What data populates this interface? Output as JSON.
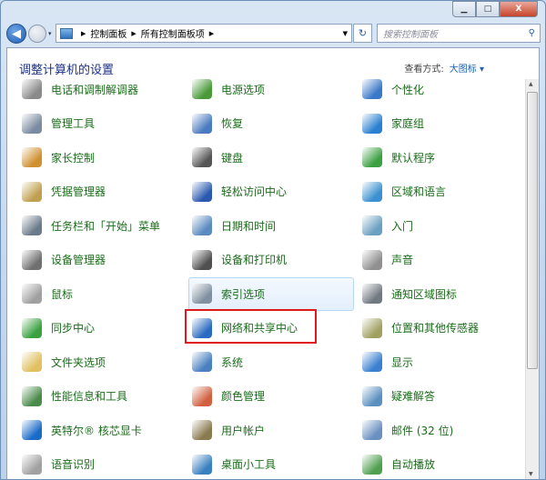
{
  "window": {
    "minimize": "▁",
    "maximize": "□",
    "close": "X"
  },
  "nav": {
    "back": "◀",
    "dropdown": "▾"
  },
  "breadcrumb": [
    "控制面板",
    "所有控制面板项"
  ],
  "search": {
    "placeholder": "搜索控制面板",
    "icon": "⚲"
  },
  "refresh": "↻",
  "header": {
    "title": "调整计算机的设置",
    "view_label": "查看方式:",
    "view_value": "大图标 ▾"
  },
  "items": [
    {
      "label": "电话和调制解调器",
      "icon": "phone-modem-icon",
      "color": "#8a8a8a"
    },
    {
      "label": "电源选项",
      "icon": "power-icon",
      "color": "#4a9a3a"
    },
    {
      "label": "个性化",
      "icon": "personalize-icon",
      "color": "#3a78c8"
    },
    {
      "label": "管理工具",
      "icon": "admin-tools-icon",
      "color": "#7a8aa0"
    },
    {
      "label": "恢复",
      "icon": "recovery-icon",
      "color": "#4a7ac0"
    },
    {
      "label": "家庭组",
      "icon": "homegroup-icon",
      "color": "#2a80d0"
    },
    {
      "label": "家长控制",
      "icon": "parental-icon",
      "color": "#d09030"
    },
    {
      "label": "键盘",
      "icon": "keyboard-icon",
      "color": "#555555"
    },
    {
      "label": "默认程序",
      "icon": "default-programs-icon",
      "color": "#3aa040"
    },
    {
      "label": "凭据管理器",
      "icon": "credential-icon",
      "color": "#c0a050"
    },
    {
      "label": "轻松访问中心",
      "icon": "ease-access-icon",
      "color": "#2a5ab0"
    },
    {
      "label": "区域和语言",
      "icon": "region-icon",
      "color": "#3a90d0"
    },
    {
      "label": "任务栏和「开始」菜单",
      "icon": "taskbar-icon",
      "color": "#6a7a8a"
    },
    {
      "label": "日期和时间",
      "icon": "datetime-icon",
      "color": "#5a8ac0"
    },
    {
      "label": "入门",
      "icon": "getting-started-icon",
      "color": "#6aa0c0"
    },
    {
      "label": "设备管理器",
      "icon": "device-manager-icon",
      "color": "#707070"
    },
    {
      "label": "设备和打印机",
      "icon": "printer-icon",
      "color": "#505050"
    },
    {
      "label": "声音",
      "icon": "sound-icon",
      "color": "#909090"
    },
    {
      "label": "鼠标",
      "icon": "mouse-icon",
      "color": "#a0a0a0"
    },
    {
      "label": "索引选项",
      "icon": "indexing-icon",
      "color": "#8090a0"
    },
    {
      "label": "通知区域图标",
      "icon": "notification-icon",
      "color": "#707880"
    },
    {
      "label": "同步中心",
      "icon": "sync-icon",
      "color": "#3aa040"
    },
    {
      "label": "网络和共享中心",
      "icon": "network-icon",
      "color": "#2a6ac0"
    },
    {
      "label": "位置和其他传感器",
      "icon": "sensor-icon",
      "color": "#a0a060"
    },
    {
      "label": "文件夹选项",
      "icon": "folder-icon",
      "color": "#e0c060"
    },
    {
      "label": "系统",
      "icon": "system-icon",
      "color": "#4a80c0"
    },
    {
      "label": "显示",
      "icon": "display-icon",
      "color": "#3a80d0"
    },
    {
      "label": "性能信息和工具",
      "icon": "performance-icon",
      "color": "#4a8a4a"
    },
    {
      "label": "颜色管理",
      "icon": "color-management-icon",
      "color": "#d06040"
    },
    {
      "label": "疑难解答",
      "icon": "troubleshoot-icon",
      "color": "#5a90c0"
    },
    {
      "label": "英特尔® 核芯显卡",
      "icon": "intel-graphics-icon",
      "color": "#1a6ac8"
    },
    {
      "label": "用户帐户",
      "icon": "user-accounts-icon",
      "color": "#8a7a50"
    },
    {
      "label": "邮件 (32 位)",
      "icon": "mail-icon",
      "color": "#6a90c0"
    },
    {
      "label": "语音识别",
      "icon": "speech-icon",
      "color": "#a0a0a0"
    },
    {
      "label": "桌面小工具",
      "icon": "gadgets-icon",
      "color": "#3a80c0"
    },
    {
      "label": "自动播放",
      "icon": "autoplay-icon",
      "color": "#50a050"
    }
  ]
}
